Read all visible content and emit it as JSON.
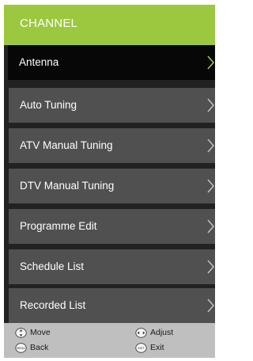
{
  "header": {
    "title": "CHANNEL"
  },
  "menu": {
    "items": [
      {
        "label": "Antenna",
        "selected": true
      },
      {
        "label": "Auto Tuning",
        "selected": false
      },
      {
        "label": "ATV Manual Tuning",
        "selected": false
      },
      {
        "label": "DTV Manual Tuning",
        "selected": false
      },
      {
        "label": "Programme Edit",
        "selected": false
      },
      {
        "label": "Schedule List",
        "selected": false
      },
      {
        "label": "Recorded List",
        "selected": false
      }
    ]
  },
  "footer": {
    "move_label": "Move",
    "adjust_label": "Adjust",
    "back_label": "Back",
    "back_icon_text": "MENU",
    "exit_label": "Exit",
    "exit_icon_text": "EXIT"
  },
  "colors": {
    "header_bg": "#9bc83e",
    "selected_item_bg": "#070707",
    "item_bg": "#505050",
    "chevron_selected": "#9bc83e",
    "chevron": "#bdbdbd",
    "footer_bg": "#bfbfbf"
  },
  "icons": {
    "chevron": "chevron-right-icon",
    "move": "up-down-arrows-icon",
    "adjust": "left-right-arrows-icon",
    "back": "menu-key-icon",
    "exit": "exit-key-icon"
  }
}
